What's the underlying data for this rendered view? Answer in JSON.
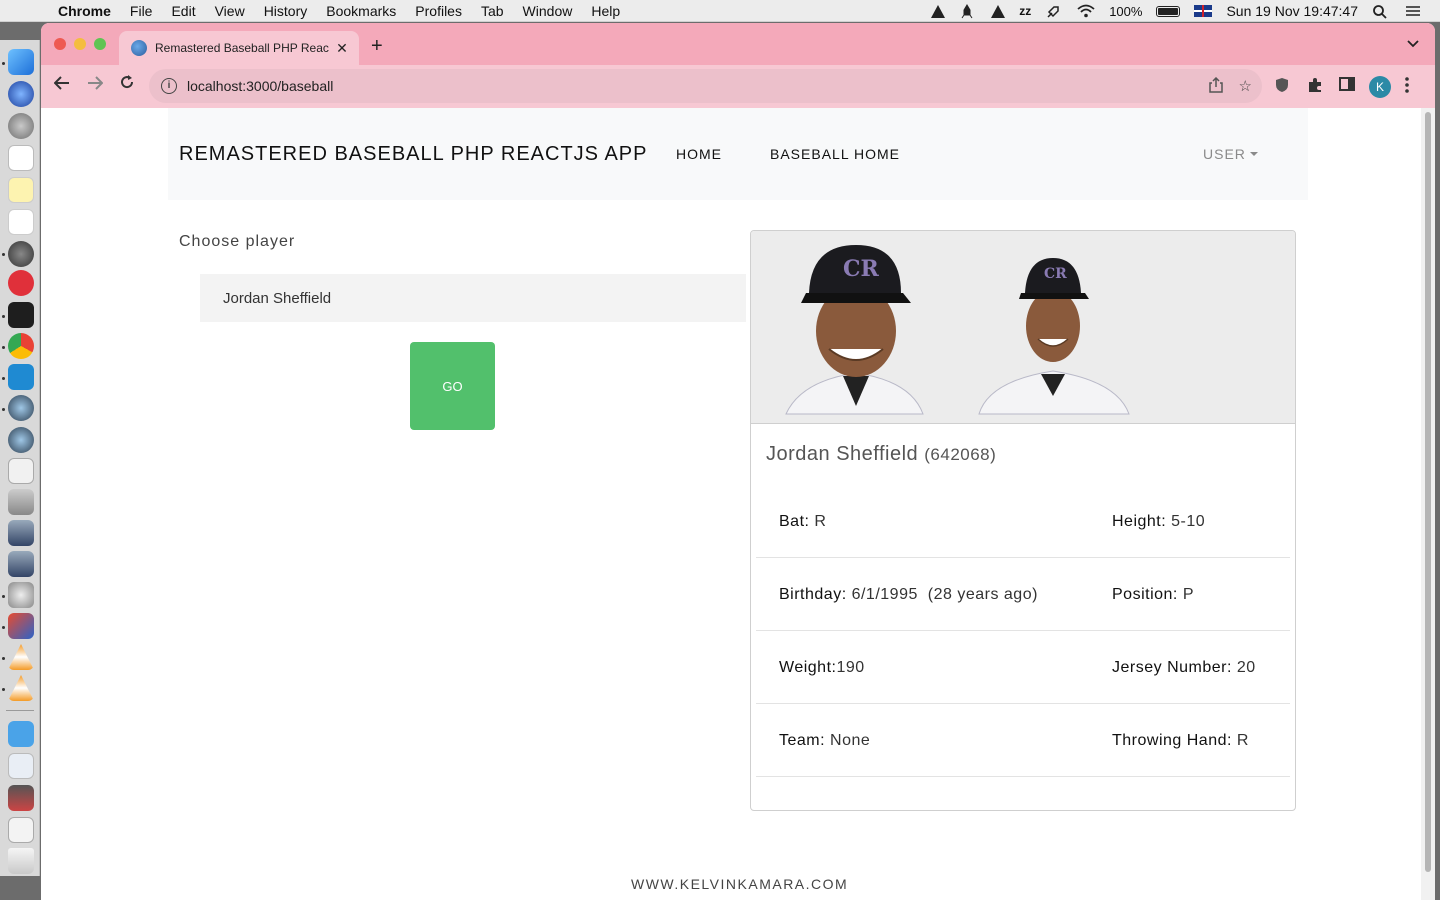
{
  "menubar": {
    "app": "Chrome",
    "items": [
      "File",
      "Edit",
      "View",
      "History",
      "Bookmarks",
      "Profiles",
      "Tab",
      "Window",
      "Help"
    ],
    "battery": "100%",
    "datetime": "Sun 19 Nov  19:47:47"
  },
  "browser": {
    "tab_title": "Remastered Baseball PHP Reac",
    "url": "localhost:3000/baseball",
    "profile_initial": "K"
  },
  "page": {
    "brand": "REMASTERED BASEBALL PHP REACTJS APP",
    "nav": {
      "home": "HOME",
      "baseball_home": "BASEBALL HOME",
      "user": "USER"
    },
    "form": {
      "label": "Choose player",
      "selected_player": "Jordan Sheffield",
      "go_label": "GO"
    },
    "card": {
      "name": "Jordan Sheffield",
      "player_id": "(642068)",
      "rows": [
        {
          "left_label": "Bat:",
          "left_value": " R",
          "right_label": "Height:",
          "right_value": " 5-10"
        },
        {
          "left_label": "Birthday:",
          "left_value": " 6/1/1995  (28 years ago)",
          "right_label": "Position:",
          "right_value": " P"
        },
        {
          "left_label": "Weight:",
          "left_value": "190",
          "right_label": "Jersey Number:",
          "right_value": " 20"
        },
        {
          "left_label": "Team:",
          "left_value": " None",
          "right_label": "Throwing Hand:",
          "right_value": " R"
        }
      ]
    },
    "footer": "WWW.KELVINKAMARA.COM"
  },
  "colors": {
    "tab_bar": "#f4a9ba",
    "go_button": "#52c06c",
    "navbar_bg": "#f8f9fa"
  }
}
